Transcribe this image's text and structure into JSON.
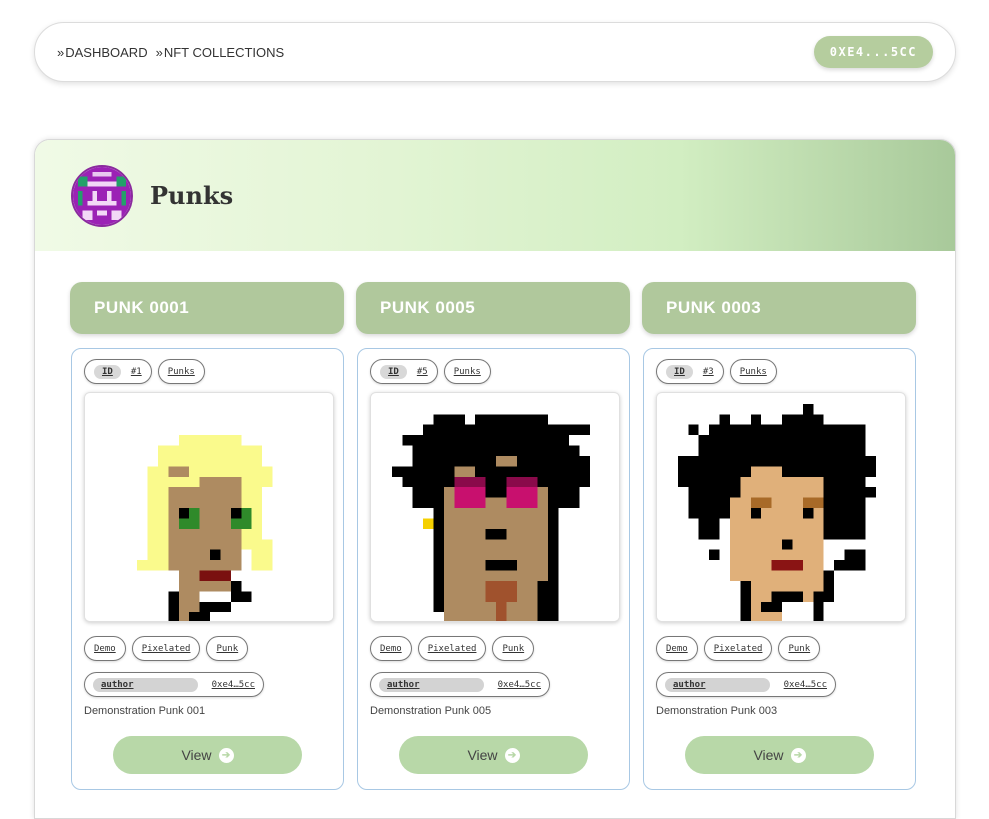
{
  "nav": {
    "crumbs": [
      {
        "arrow": "»",
        "label": "DASHBOARD"
      },
      {
        "arrow": "»",
        "label": "NFT COLLECTIONS"
      }
    ],
    "wallet": "0XE4...5CC"
  },
  "collection": {
    "title": "Punks"
  },
  "items": [
    {
      "header": "PUNK 0001",
      "id_key": "ID",
      "id_value": "#1",
      "collection_tag": "Punks",
      "tags": [
        "Demo",
        "Pixelated",
        "Punk"
      ],
      "author_key": "author",
      "author_value": "0xe4…5cc",
      "description": "Demonstration Punk 001",
      "view_label": "View"
    },
    {
      "header": "PUNK 0005",
      "id_key": "ID",
      "id_value": "#5",
      "collection_tag": "Punks",
      "tags": [
        "Demo",
        "Pixelated",
        "Punk"
      ],
      "author_key": "author",
      "author_value": "0xe4…5cc",
      "description": "Demonstration Punk 005",
      "view_label": "View"
    },
    {
      "header": "PUNK 0003",
      "id_key": "ID",
      "id_value": "#3",
      "collection_tag": "Punks",
      "tags": [
        "Demo",
        "Pixelated",
        "Punk"
      ],
      "author_key": "author",
      "author_value": "0xe4…5cc",
      "description": "Demonstration Punk 003",
      "view_label": "View"
    }
  ],
  "colors": {
    "accent": "#b0c89c",
    "button": "#b8d8a8",
    "card_border": "#a8c8e4"
  }
}
